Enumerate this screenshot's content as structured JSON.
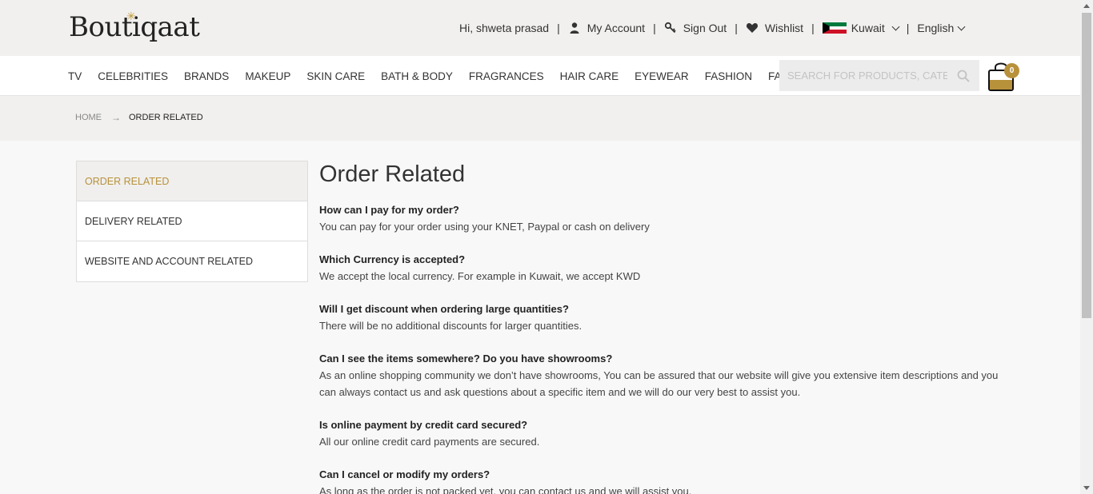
{
  "logo": {
    "text": "Boutiqaat",
    "alt": "Boutiqaat logo"
  },
  "topbar": {
    "greeting": "Hi, shweta prasad",
    "my_account": "My Account",
    "sign_out": "Sign Out",
    "wishlist": "Wishlist",
    "country": "Kuwait",
    "language": "English",
    "separator": "|"
  },
  "nav": {
    "items": [
      "TV",
      "CELEBRITIES",
      "BRANDS",
      "MAKEUP",
      "SKIN CARE",
      "BATH & BODY",
      "FRAGRANCES",
      "HAIR CARE",
      "EYEWEAR",
      "FASHION",
      "FASHION TECH"
    ],
    "search_placeholder": "SEARCH FOR PRODUCTS, CATEGORIES",
    "cart_count": "0"
  },
  "breadcrumb": {
    "home": "HOME",
    "arrow": "→",
    "current": "ORDER RELATED"
  },
  "sidebar": {
    "items": [
      {
        "label": "ORDER RELATED"
      },
      {
        "label": "DELIVERY RELATED"
      },
      {
        "label": "WEBSITE AND ACCOUNT RELATED"
      }
    ]
  },
  "main": {
    "title": "Order Related",
    "faqs": [
      {
        "q": "How can I pay for my order?",
        "a": "You can pay for your order using your KNET, Paypal or cash on delivery"
      },
      {
        "q": "Which Currency is accepted?",
        "a": "We accept the local currency. For example in Kuwait, we accept KWD"
      },
      {
        "q": "Will I get discount when ordering large quantities?",
        "a": "There will be no additional discounts for larger quantities."
      },
      {
        "q": "Can I see the items somewhere? Do you have showrooms?",
        "a": "As an online shopping community we don’t have showrooms, You can be assured that our website will give you extensive item descriptions and you can always contact us and ask questions about a specific item and we will do our very best to assist you."
      },
      {
        "q": "Is online payment by credit card secured?",
        "a": "All our online credit card payments are secured."
      },
      {
        "q": "Can I cancel or modify my orders?",
        "a": "As long as the order is not packed yet, you can contact us and we will assist you."
      }
    ]
  },
  "colors": {
    "accent": "#b8913b",
    "topbar_bg": "#f1f0ee",
    "kuwait_green": "#007a3d",
    "kuwait_red": "#ce1126"
  }
}
